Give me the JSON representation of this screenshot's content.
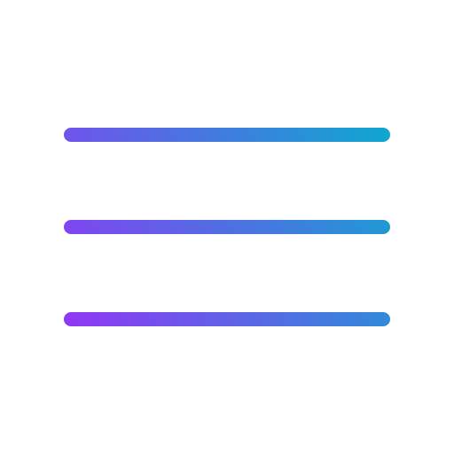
{
  "icon": {
    "name": "hamburger-menu-icon",
    "bars": 3
  },
  "colors": {
    "background": "#ffffff",
    "gradient_start": "#9236F5",
    "gradient_end": "#0EA8D0"
  }
}
